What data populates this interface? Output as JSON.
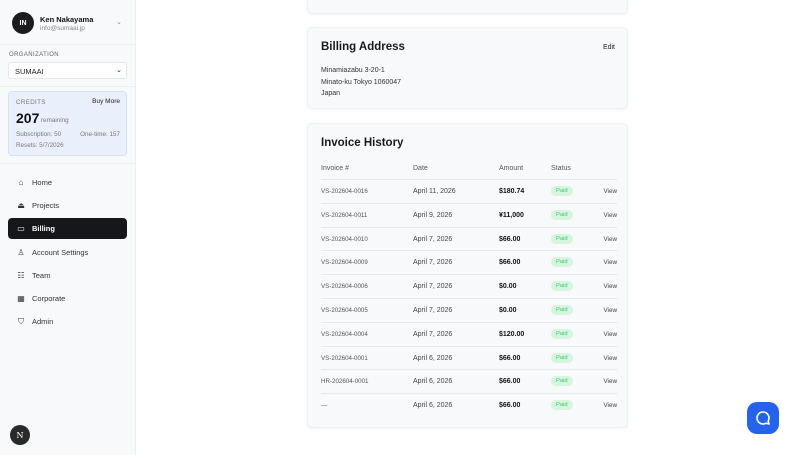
{
  "user": {
    "initials": "IN",
    "name": "Ken Nakayama",
    "email": "info@sumaai.jp"
  },
  "organization": {
    "label": "ORGANIZATION",
    "selected": "SUMAAI"
  },
  "credits": {
    "title": "CREDITS",
    "buy_more": "Buy More",
    "count": "207",
    "remaining": "remaining",
    "subscription": "Subscription: 50",
    "one_time": "One-time: 157",
    "resets": "Resets: 5/7/2026"
  },
  "nav": [
    {
      "label": "Home"
    },
    {
      "label": "Projects"
    },
    {
      "label": "Billing"
    },
    {
      "label": "Account Settings"
    },
    {
      "label": "Team"
    },
    {
      "label": "Corporate"
    },
    {
      "label": "Admin"
    }
  ],
  "bottom_badge": "N",
  "billing_address": {
    "title": "Billing Address",
    "edit": "Edit",
    "line1": "Minamiazabu 3-20-1",
    "line2": "Minato-ku Tokyo 1060047",
    "line3": "Japan"
  },
  "invoice_history": {
    "title": "Invoice History",
    "headers": [
      "Invoice #",
      "Date",
      "Amount",
      "Status"
    ],
    "rows": [
      {
        "id": "VS-202604-0016",
        "date": "April 11, 2026",
        "amount": "$180.74",
        "status": "Paid",
        "action": "View"
      },
      {
        "id": "VS-202604-0011",
        "date": "April 9, 2026",
        "amount": "¥11,000",
        "status": "Paid",
        "action": "View"
      },
      {
        "id": "VS-202604-0010",
        "date": "April 7, 2026",
        "amount": "$66.00",
        "status": "Paid",
        "action": "View"
      },
      {
        "id": "VS-202604-0009",
        "date": "April 7, 2026",
        "amount": "$66.00",
        "status": "Paid",
        "action": "View"
      },
      {
        "id": "VS-202604-0006",
        "date": "April 7, 2026",
        "amount": "$0.00",
        "status": "Paid",
        "action": "View"
      },
      {
        "id": "VS-202604-0005",
        "date": "April 7, 2026",
        "amount": "$0.00",
        "status": "Paid",
        "action": "View"
      },
      {
        "id": "VS-202604-0004",
        "date": "April 7, 2026",
        "amount": "$120.00",
        "status": "Paid",
        "action": "View"
      },
      {
        "id": "VS-202604-0001",
        "date": "April 6, 2026",
        "amount": "$66.00",
        "status": "Paid",
        "action": "View"
      },
      {
        "id": "HR-202604-0001",
        "date": "April 6, 2026",
        "amount": "$66.00",
        "status": "Paid",
        "action": "View"
      },
      {
        "id": "—",
        "date": "April 6, 2026",
        "amount": "$66.00",
        "status": "Paid",
        "action": "View"
      }
    ]
  }
}
